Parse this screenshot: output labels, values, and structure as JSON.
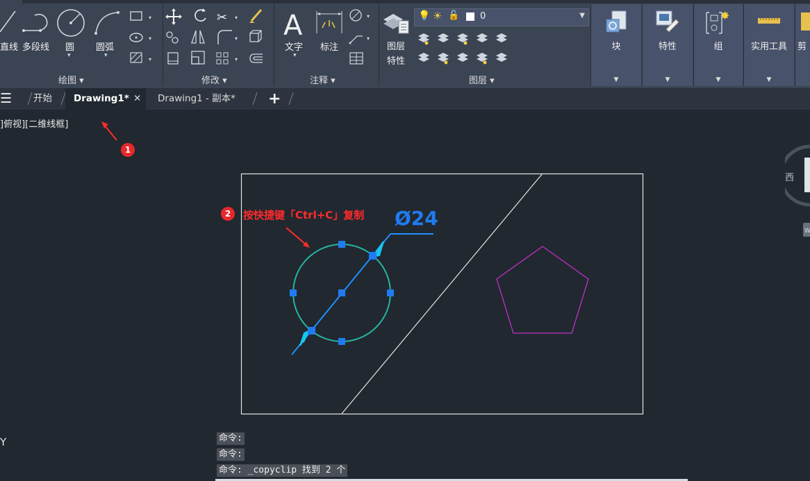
{
  "ribbon": {
    "draw_panel": {
      "title": "绘图 ▾",
      "buttons": {
        "line": "直线",
        "polyline": "多段线",
        "circle": "圆",
        "arc": "圆弧"
      }
    },
    "modify_panel": {
      "title": "修改 ▾"
    },
    "annotation_panel": {
      "title": "注释 ▾",
      "buttons": {
        "text": "文字",
        "dimension": "标注"
      }
    },
    "layers_panel": {
      "title": "图层 ▾",
      "layer_props_line1": "图层",
      "layer_props_line2": "特性",
      "current_layer": "0"
    },
    "big_buttons": {
      "block": "块",
      "properties": "特性",
      "group": "组",
      "utilities": "实用工具",
      "clipboard": "剪"
    }
  },
  "tabs": {
    "start": "开始",
    "drawing1": "Drawing1*",
    "drawing1_copy": "Drawing1 - 副本*",
    "close_glyph": "✕",
    "add_glyph": "+"
  },
  "viewport": {
    "label": "]俯视][二维线框]"
  },
  "annotations": {
    "badge1": "1",
    "badge2": "2",
    "note2": "按快捷键「Ctrl+C」复制"
  },
  "drawing": {
    "dimension_text": "Ø24",
    "compass_west": "西",
    "compass_w_tag": "W",
    "ucs_y": "Y"
  },
  "command_history": [
    "命令:",
    "命令:",
    "命令: _copyclip 找到 2 个"
  ],
  "colors": {
    "ribbon_bg": "#3b4453",
    "canvas_bg": "#212830",
    "selection_blue": "#1f7cf0",
    "circle_teal": "#27b3a1",
    "pentagon_magenta": "#c030c8",
    "annotation_red": "#ff2b2b"
  }
}
